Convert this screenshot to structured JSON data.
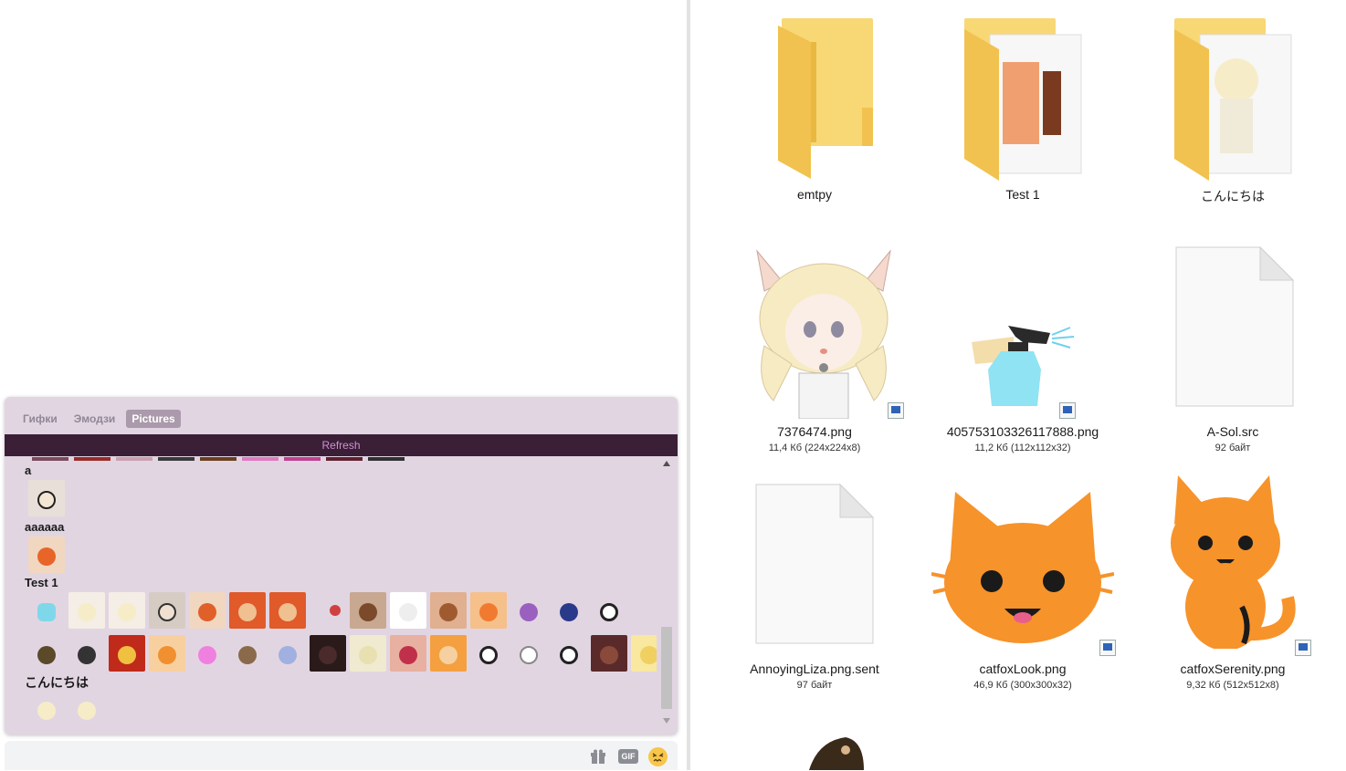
{
  "picker": {
    "tabs": [
      "Гифки",
      "Эмодзи",
      "Pictures"
    ],
    "active_tab": "Pictures",
    "refresh_label": "Refresh",
    "folders": [
      {
        "label": "a",
        "thumbs": 1
      },
      {
        "label": "aaaaaa",
        "thumbs": 1
      },
      {
        "label": "Test 1",
        "thumbs": 30
      },
      {
        "label": "こんにちは",
        "thumbs": 2
      }
    ]
  },
  "chat_bar": {
    "gif_label": "GIF"
  },
  "explorer": {
    "items": [
      {
        "name": "emtpy",
        "meta": ""
      },
      {
        "name": "Test 1",
        "meta": ""
      },
      {
        "name": "こんにちは",
        "meta": ""
      },
      {
        "name": "7376474.png",
        "meta": "11,4 Кб (224x224x8)"
      },
      {
        "name": "405753103326117888.png",
        "meta": "11,2 Кб (112x112x32)"
      },
      {
        "name": "A-Sol.src",
        "meta": "92 байт"
      },
      {
        "name": "AnnoyingLiza.png.sent",
        "meta": "97 байт"
      },
      {
        "name": "catfoxLook.png",
        "meta": "46,9 Кб (300x300x32)"
      },
      {
        "name": "catfoxSerenity.png",
        "meta": "9,32 Кб (512x512x8)"
      }
    ]
  },
  "colors": {
    "picker_bg": "#e2d5e2",
    "refresh_bar": "#3a1f37",
    "refresh_text": "#d08fd0",
    "folder_yellow": "#f8d775",
    "cat_orange": "#f6932a"
  }
}
